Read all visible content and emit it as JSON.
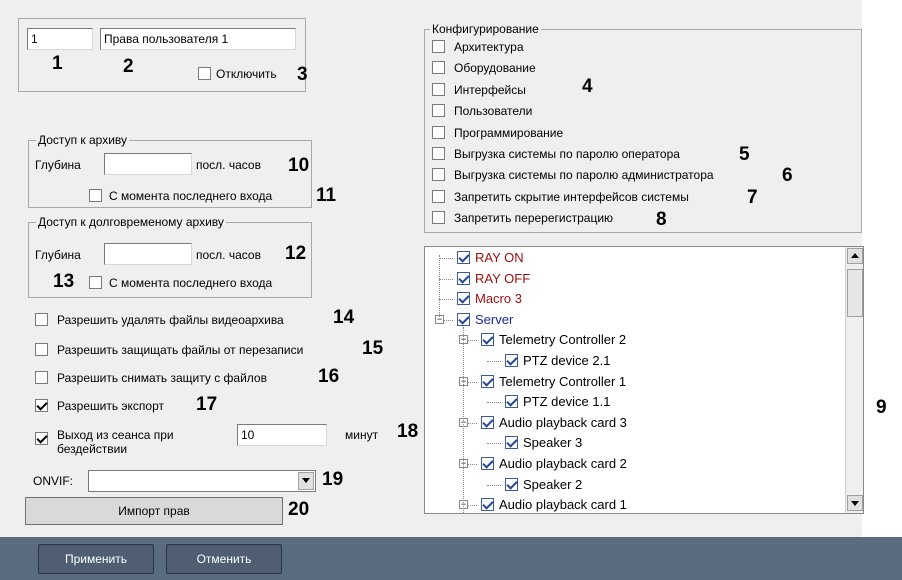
{
  "user": {
    "id": "1",
    "name": "Права пользователя 1",
    "disable_label": "Отключить"
  },
  "archive": {
    "title": "Доступ к архиву",
    "depth_label": "Глубина",
    "depth_value": "",
    "hours_label": "посл. часов",
    "since_login_label": "С момента последнего входа"
  },
  "long_archive": {
    "title": "Доступ к долговременому архиву",
    "depth_label": "Глубина",
    "depth_value": "",
    "hours_label": "посл. часов",
    "since_login_label": "С момента последнего входа"
  },
  "options": [
    {
      "label": "Разрешить удалять файлы видеоархива",
      "checked": false
    },
    {
      "label": "Разрешить защищать файлы от перезаписи",
      "checked": false
    },
    {
      "label": "Разрешить снимать защиту с файлов",
      "checked": false
    },
    {
      "label": "Разрешить экспорт",
      "checked": true
    }
  ],
  "idle_exit": {
    "label_line1": "Выход из сеанса при",
    "label_line2": "бездействии",
    "checked": true,
    "value": "10",
    "unit": "минут"
  },
  "onvif": {
    "label": "ONVIF:",
    "value": ""
  },
  "import_button": "Импорт прав",
  "config": {
    "title": "Конфигурирование",
    "items": [
      "Архитектура",
      "Оборудование",
      "Интерфейсы",
      "Пользователи",
      "Программирование",
      "Выгрузка системы по паролю оператора",
      "Выгрузка системы по паролю администратора",
      "Запретить скрытие интерфейсов системы",
      "Запретить перерегистрацию"
    ]
  },
  "tree": [
    {
      "label": "RAY ON",
      "color": "#a01010"
    },
    {
      "label": "RAY OFF",
      "color": "#a01010"
    },
    {
      "label": "Macro 3",
      "color": "#a01010"
    },
    {
      "label": "Server",
      "color": "#1a2a9a"
    },
    {
      "label": "Telemetry Controller 2",
      "color": "#000000"
    },
    {
      "label": "PTZ device 2.1",
      "color": "#000000"
    },
    {
      "label": "Telemetry Controller 1",
      "color": "#000000"
    },
    {
      "label": "PTZ device 1.1",
      "color": "#000000"
    },
    {
      "label": "Audio playback card 3",
      "color": "#000000"
    },
    {
      "label": "Speaker 3",
      "color": "#000000"
    },
    {
      "label": "Audio playback card 2",
      "color": "#000000"
    },
    {
      "label": "Speaker 2",
      "color": "#000000"
    },
    {
      "label": "Audio playback card 1",
      "color": "#000000"
    }
  ],
  "callouts": [
    "1",
    "2",
    "3",
    "4",
    "5",
    "6",
    "7",
    "8",
    "9",
    "10",
    "11",
    "12",
    "13",
    "14",
    "15",
    "16",
    "17",
    "18",
    "19",
    "20"
  ],
  "footer": {
    "apply": "Применить",
    "cancel": "Отменить"
  }
}
